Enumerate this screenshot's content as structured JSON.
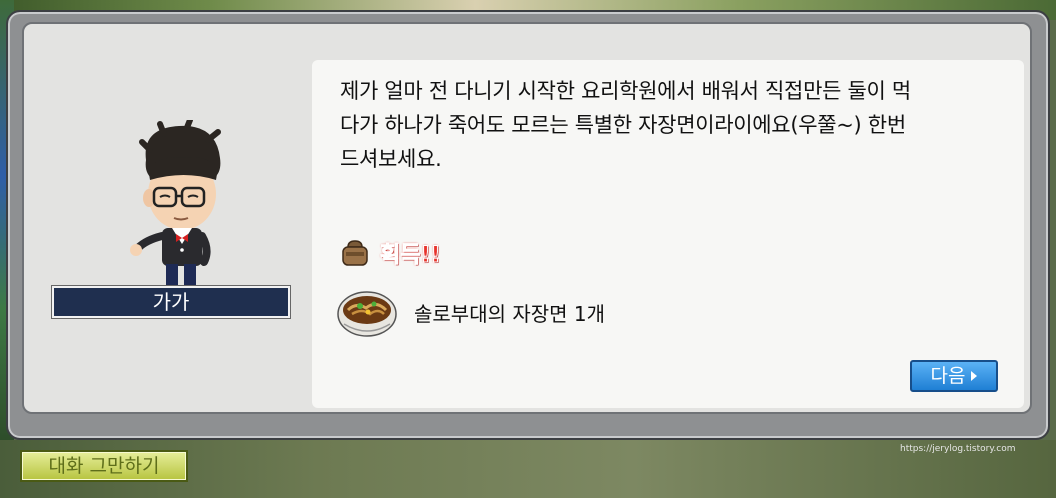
{
  "npc": {
    "name": "가가",
    "portrait_icon": "npc-glasses-man-portrait"
  },
  "dialogue": {
    "lines": [
      "제가 얼마 전 다니기 시작한 요리학원에서 배워서 직접만든 둘이 먹",
      "다가 하나가 죽어도 모르는 특별한 자장면이라이에요(우쭐~) 한번",
      "드셔보세요."
    ]
  },
  "reward": {
    "acquire_label": "획득!!",
    "bag_icon": "item-bag-icon",
    "item_icon": "jajangmyeon-bowl-icon",
    "item_text": "솔로부대의 자장면 1개"
  },
  "buttons": {
    "next_label": "다음",
    "end_chat_label": "대화 그만하기"
  },
  "watermark": "https://jerylog.tistory.com",
  "colors": {
    "name_bg": "#1f2f4f",
    "acquire_red": "#e8342c",
    "next_blue": "#1f7fd4",
    "end_green": "#b7c43f"
  }
}
